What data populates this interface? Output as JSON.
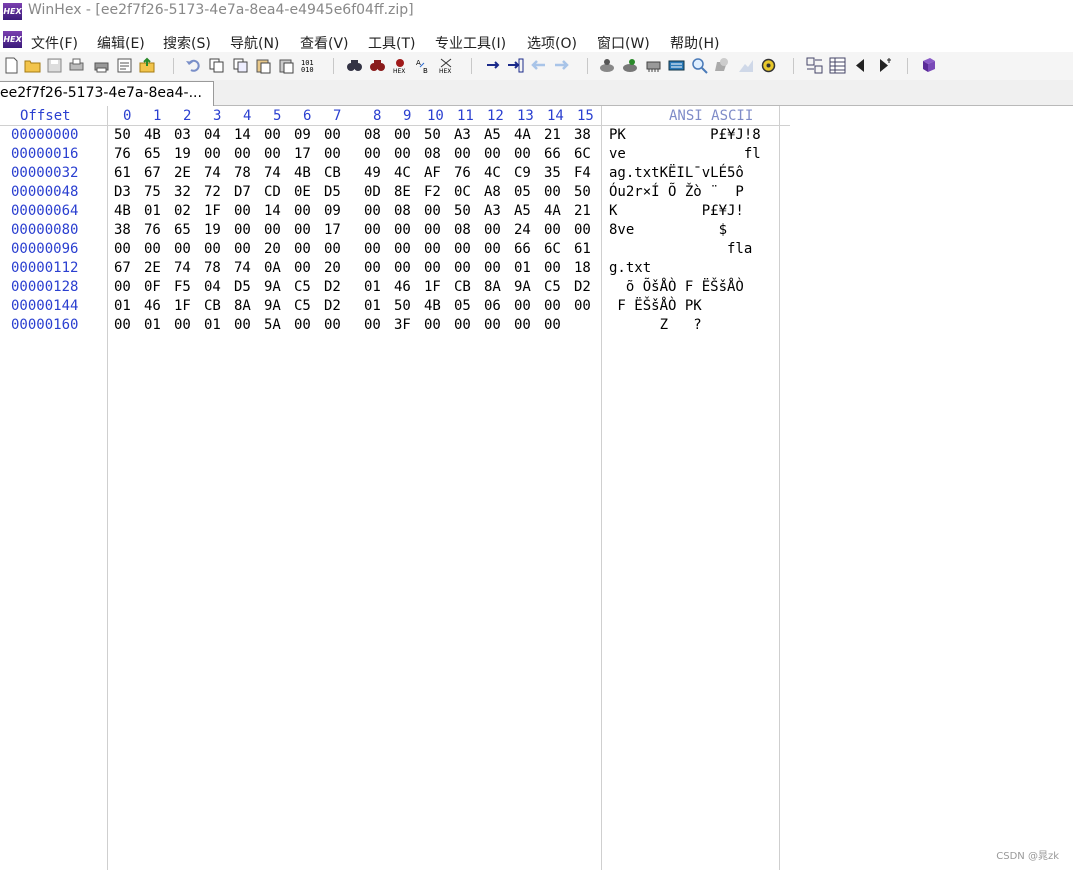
{
  "window": {
    "title": "WinHex - [ee2f7f26-5173-4e7a-8ea4-e4945e6f04ff.zip]",
    "app_icon": "winhex-logo-icon",
    "app_icon_text": "HEX"
  },
  "menu": {
    "items": [
      {
        "label": "文件(F)"
      },
      {
        "label": "编辑(E)"
      },
      {
        "label": "搜索(S)"
      },
      {
        "label": "导航(N)"
      },
      {
        "label": "查看(V)"
      },
      {
        "label": "工具(T)"
      },
      {
        "label": "专业工具(I)"
      },
      {
        "label": "选项(O)"
      },
      {
        "label": "窗口(W)"
      },
      {
        "label": "帮助(H)"
      }
    ]
  },
  "toolbar": {
    "icons": [
      "new-file-icon",
      "open-folder-icon",
      "save-icon",
      "print-preview-icon",
      "print-icon",
      "properties-icon",
      "export-icon",
      "undo-icon",
      "copy-icon",
      "copy-hex-icon",
      "paste-icon",
      "paste-hex-icon",
      "binary-icon",
      "find-text-icon",
      "find-hex-icon",
      "find-hex-alt-icon",
      "replace-text-icon",
      "replace-hex-icon",
      "goto-offset-icon",
      "goto-end-icon",
      "back-icon",
      "forward-icon",
      "disk-open-icon",
      "ram-icon",
      "disk-tools-icon",
      "calculator-icon",
      "magnifier-icon",
      "hash-icon",
      "tools-icon",
      "settings-icon",
      "template-icon",
      "table-icon",
      "prev-page-icon",
      "next-page-icon",
      "help-book-icon"
    ]
  },
  "tab": {
    "label": "ee2f7f26-5173-4e7a-8ea4-..."
  },
  "hex_view": {
    "offset_header": "Offset",
    "column_headers": [
      "0",
      "1",
      "2",
      "3",
      "4",
      "5",
      "6",
      "7",
      "8",
      "9",
      "10",
      "11",
      "12",
      "13",
      "14",
      "15"
    ],
    "ansi_header": "ANSI ASCII",
    "rows": [
      {
        "offset": "00000000",
        "hex": [
          "50",
          "4B",
          "03",
          "04",
          "14",
          "00",
          "09",
          "00",
          "08",
          "00",
          "50",
          "A3",
          "A5",
          "4A",
          "21",
          "38"
        ],
        "ansi": "PK          P£¥J!8"
      },
      {
        "offset": "00000016",
        "hex": [
          "76",
          "65",
          "19",
          "00",
          "00",
          "00",
          "17",
          "00",
          "00",
          "00",
          "08",
          "00",
          "00",
          "00",
          "66",
          "6C"
        ],
        "ansi": "ve              fl"
      },
      {
        "offset": "00000032",
        "hex": [
          "61",
          "67",
          "2E",
          "74",
          "78",
          "74",
          "4B",
          "CB",
          "49",
          "4C",
          "AF",
          "76",
          "4C",
          "C9",
          "35",
          "F4"
        ],
        "ansi": "ag.txtKËIL¯vLÉ5ô"
      },
      {
        "offset": "00000048",
        "hex": [
          "D3",
          "75",
          "32",
          "72",
          "D7",
          "CD",
          "0E",
          "D5",
          "0D",
          "8E",
          "F2",
          "0C",
          "A8",
          "05",
          "00",
          "50"
        ],
        "ansi": "Óu2r×Í Õ Žò ¨  P"
      },
      {
        "offset": "00000064",
        "hex": [
          "4B",
          "01",
          "02",
          "1F",
          "00",
          "14",
          "00",
          "09",
          "00",
          "08",
          "00",
          "50",
          "A3",
          "A5",
          "4A",
          "21"
        ],
        "ansi": "K          P£¥J!"
      },
      {
        "offset": "00000080",
        "hex": [
          "38",
          "76",
          "65",
          "19",
          "00",
          "00",
          "00",
          "17",
          "00",
          "00",
          "00",
          "08",
          "00",
          "24",
          "00",
          "00"
        ],
        "ansi": "8ve          $"
      },
      {
        "offset": "00000096",
        "hex": [
          "00",
          "00",
          "00",
          "00",
          "00",
          "20",
          "00",
          "00",
          "00",
          "00",
          "00",
          "00",
          "00",
          "66",
          "6C",
          "61"
        ],
        "ansi": "              fla"
      },
      {
        "offset": "00000112",
        "hex": [
          "67",
          "2E",
          "74",
          "78",
          "74",
          "0A",
          "00",
          "20",
          "00",
          "00",
          "00",
          "00",
          "00",
          "01",
          "00",
          "18"
        ],
        "ansi": "g.txt"
      },
      {
        "offset": "00000128",
        "hex": [
          "00",
          "0F",
          "F5",
          "04",
          "D5",
          "9A",
          "C5",
          "D2",
          "01",
          "46",
          "1F",
          "CB",
          "8A",
          "9A",
          "C5",
          "D2"
        ],
        "ansi": "  õ ÕšÅÒ F ËŠšÅÒ"
      },
      {
        "offset": "00000144",
        "hex": [
          "01",
          "46",
          "1F",
          "CB",
          "8A",
          "9A",
          "C5",
          "D2",
          "01",
          "50",
          "4B",
          "05",
          "06",
          "00",
          "00",
          "00"
        ],
        "ansi": " F ËŠšÅÒ PK"
      },
      {
        "offset": "00000160",
        "hex": [
          "00",
          "01",
          "00",
          "01",
          "00",
          "5A",
          "00",
          "00",
          "00",
          "3F",
          "00",
          "00",
          "00",
          "00",
          "00",
          ""
        ],
        "ansi": "      Z   ?"
      }
    ]
  },
  "watermark": "CSDN @晁zk",
  "colors": {
    "offset_blue": "#2a3fd0",
    "ansi_header": "#7f8cc8",
    "title_gray": "#888888"
  }
}
